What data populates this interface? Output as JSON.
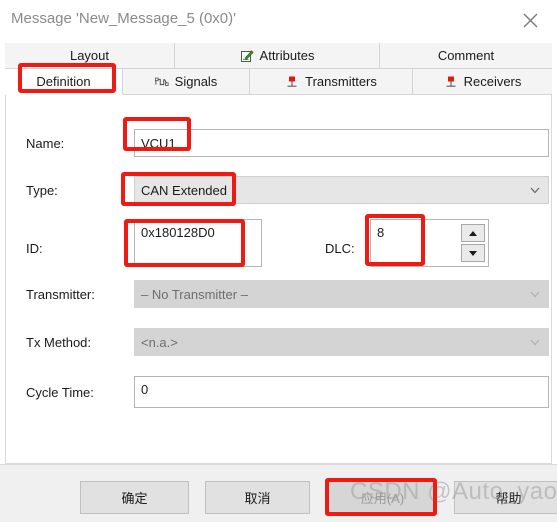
{
  "window": {
    "title": "Message 'New_Message_5 (0x0)'",
    "close_icon": "close-icon"
  },
  "tabs": {
    "row1": [
      {
        "label": "Layout",
        "icon": "",
        "active": false
      },
      {
        "label": "Attributes",
        "icon": "attributes-pencil-icon",
        "active": false
      },
      {
        "label": "Comment",
        "icon": "",
        "active": false
      }
    ],
    "row2": [
      {
        "label": "Definition",
        "icon": "",
        "active": true
      },
      {
        "label": "Signals",
        "icon": "signal-waveform-icon",
        "active": false
      },
      {
        "label": "Transmitters",
        "icon": "node-pin-icon",
        "active": false
      },
      {
        "label": "Receivers",
        "icon": "node-pin-icon",
        "active": false
      }
    ]
  },
  "form": {
    "name": {
      "label": "Name:",
      "value": "VCU1"
    },
    "type": {
      "label": "Type:",
      "value": "CAN Extended"
    },
    "id": {
      "label": "ID:",
      "value": "0x180128D0"
    },
    "dlc": {
      "label": "DLC:",
      "value": "8"
    },
    "transmitter": {
      "label": "Transmitter:",
      "value": "– No Transmitter –"
    },
    "tx_method": {
      "label": "Tx Method:",
      "value": "<n.a.>"
    },
    "cycle_time": {
      "label": "Cycle Time:",
      "value": "0"
    }
  },
  "buttons": {
    "ok": "确定",
    "cancel": "取消",
    "apply": "应用(A)",
    "help": "帮助"
  },
  "watermark": {
    "brand": "CSDN",
    "user": "@Auto_yaoyao"
  },
  "colors": {
    "annotation_red": "#ef1a12",
    "tab_strip_bg": "#f4f4f4",
    "disabled_field": "#d4d4d4",
    "combo_field": "#e6e6e6",
    "button_bar": "#f0f0f0"
  }
}
